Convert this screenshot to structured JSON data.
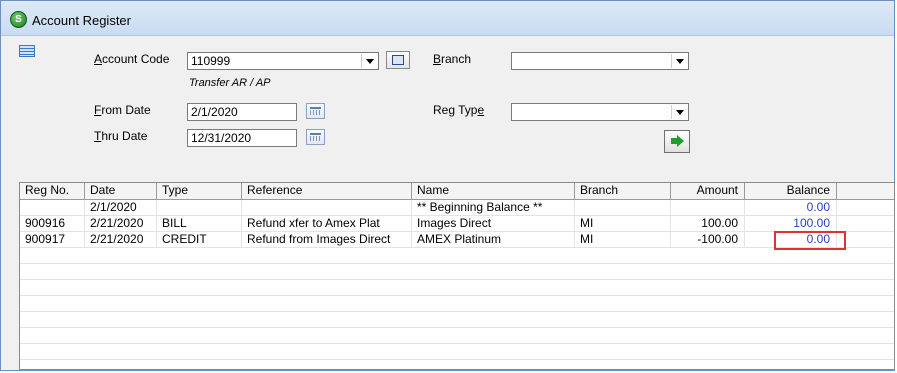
{
  "window": {
    "title": "Account Register"
  },
  "form": {
    "account_code_label_u": "A",
    "account_code_label_rest": "ccount Code",
    "account_code_value": "110999",
    "account_desc": "Transfer AR / AP",
    "branch_label_u": "B",
    "branch_label_rest": "ranch",
    "branch_value": "",
    "from_date_label_u": "F",
    "from_date_label_rest": "rom Date",
    "from_date_value": "2/1/2020",
    "thru_date_label_u": "T",
    "thru_date_label_rest": "hru Date",
    "thru_date_value": "12/31/2020",
    "reg_type_label_pre": "Reg Typ",
    "reg_type_label_u": "e",
    "reg_type_value": ""
  },
  "grid": {
    "columns": [
      "Reg No.",
      "Date",
      "Type",
      "Reference",
      "Name",
      "Branch",
      "Amount",
      "Balance"
    ],
    "rows": [
      {
        "reg_no": "",
        "date": "2/1/2020",
        "type": "",
        "reference": "",
        "name": "** Beginning Balance **",
        "branch": "",
        "amount": "",
        "balance": "0.00"
      },
      {
        "reg_no": "900916",
        "date": "2/21/2020",
        "type": "BILL",
        "reference": "Refund xfer to Amex Plat",
        "name": "Images Direct",
        "branch": "MI",
        "amount": "100.00",
        "balance": "100.00"
      },
      {
        "reg_no": "900917",
        "date": "2/21/2020",
        "type": "CREDIT",
        "reference": "Refund from Images Direct",
        "name": "AMEX Platinum",
        "branch": "MI",
        "amount": "-100.00",
        "balance": "0.00"
      }
    ]
  },
  "colors": {
    "balance_text": "#2a3fc0",
    "highlight": "#e03030",
    "title_bar": "#dde9f7"
  }
}
